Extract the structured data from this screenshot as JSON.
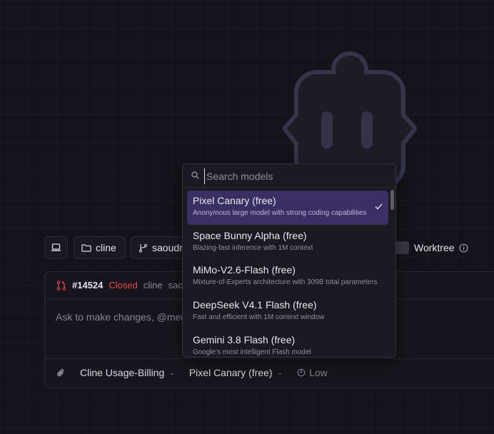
{
  "toolbar": {
    "folder_label": "cline",
    "branch_label": "saoudr",
    "worktree_label": "Worktree"
  },
  "card": {
    "pr_number": "#14524",
    "pr_status": "Closed",
    "pr_repo": "cline",
    "pr_author": "saou",
    "prompt_placeholder": "Ask to make changes, @men",
    "billing_label": "Cline Usage-Billing",
    "model_label": "Pixel Canary (free)",
    "effort_label": "Low"
  },
  "dropdown": {
    "search_placeholder": "Search models",
    "models": [
      {
        "name": "Pixel Canary (free)",
        "description": "Anonymous large model with strong coding capabilities",
        "selected": true
      },
      {
        "name": "Space Bunny Alpha (free)",
        "description": "Blazing-fast inference with 1M context",
        "selected": false
      },
      {
        "name": "MiMo-V2.6-Flash (free)",
        "description": "Mixture-of-Experts architecture with 309B total parameters",
        "selected": false
      },
      {
        "name": "DeepSeek V4.1 Flash (free)",
        "description": "Fast and efficient with 1M context window",
        "selected": false
      },
      {
        "name": "Gemini 3.8 Flash (free)",
        "description": "Google's most intelligent Flash model",
        "selected": false
      }
    ]
  },
  "colors": {
    "background": "#141319",
    "selected_item": "#3a2f63",
    "closed_status": "#e5484d",
    "pr_icon": "#e5484d"
  }
}
